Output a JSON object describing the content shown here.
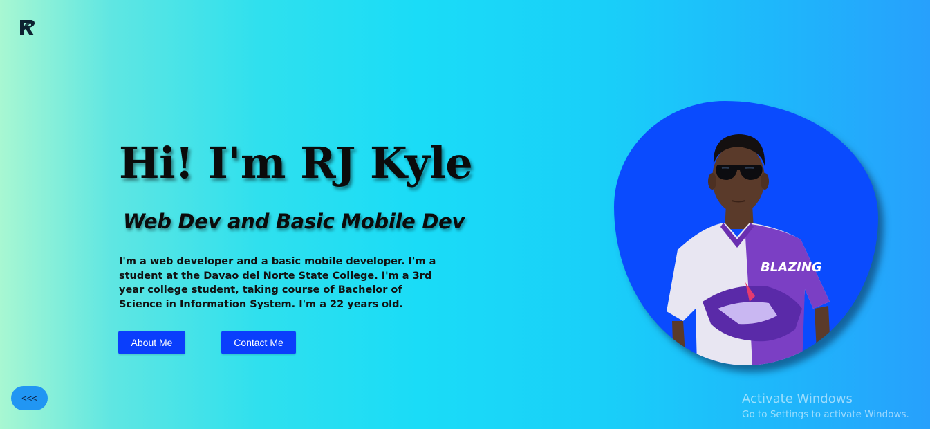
{
  "brand": {
    "logo_icon": "rk-monogram-icon"
  },
  "hero": {
    "title": "Hi! I'm RJ Kyle",
    "subtitle": "Web Dev and Basic Mobile Dev",
    "description": "I'm a web developer and a basic mobile developer. I'm a student at the Davao del Norte State College. I'm a 3rd year college student, taking course of Bachelor of Science in Information System. I'm a 22 years old.",
    "buttons": {
      "about_label": "About Me",
      "contact_label": "Contact Me"
    }
  },
  "nav": {
    "back_label": "<<<"
  },
  "profile": {
    "photo_icon": "profile-photo",
    "shirt_text": "BLAZING"
  },
  "os_watermark": {
    "title": "Activate Windows",
    "subtitle": "Go to Settings to activate Windows."
  },
  "colors": {
    "button_bg": "#0a3efc",
    "back_button_bg": "#2196f3",
    "avatar_blob": "#0a4bfe",
    "gradient_start": "#a8f7d2",
    "gradient_end": "#27a0fc"
  }
}
